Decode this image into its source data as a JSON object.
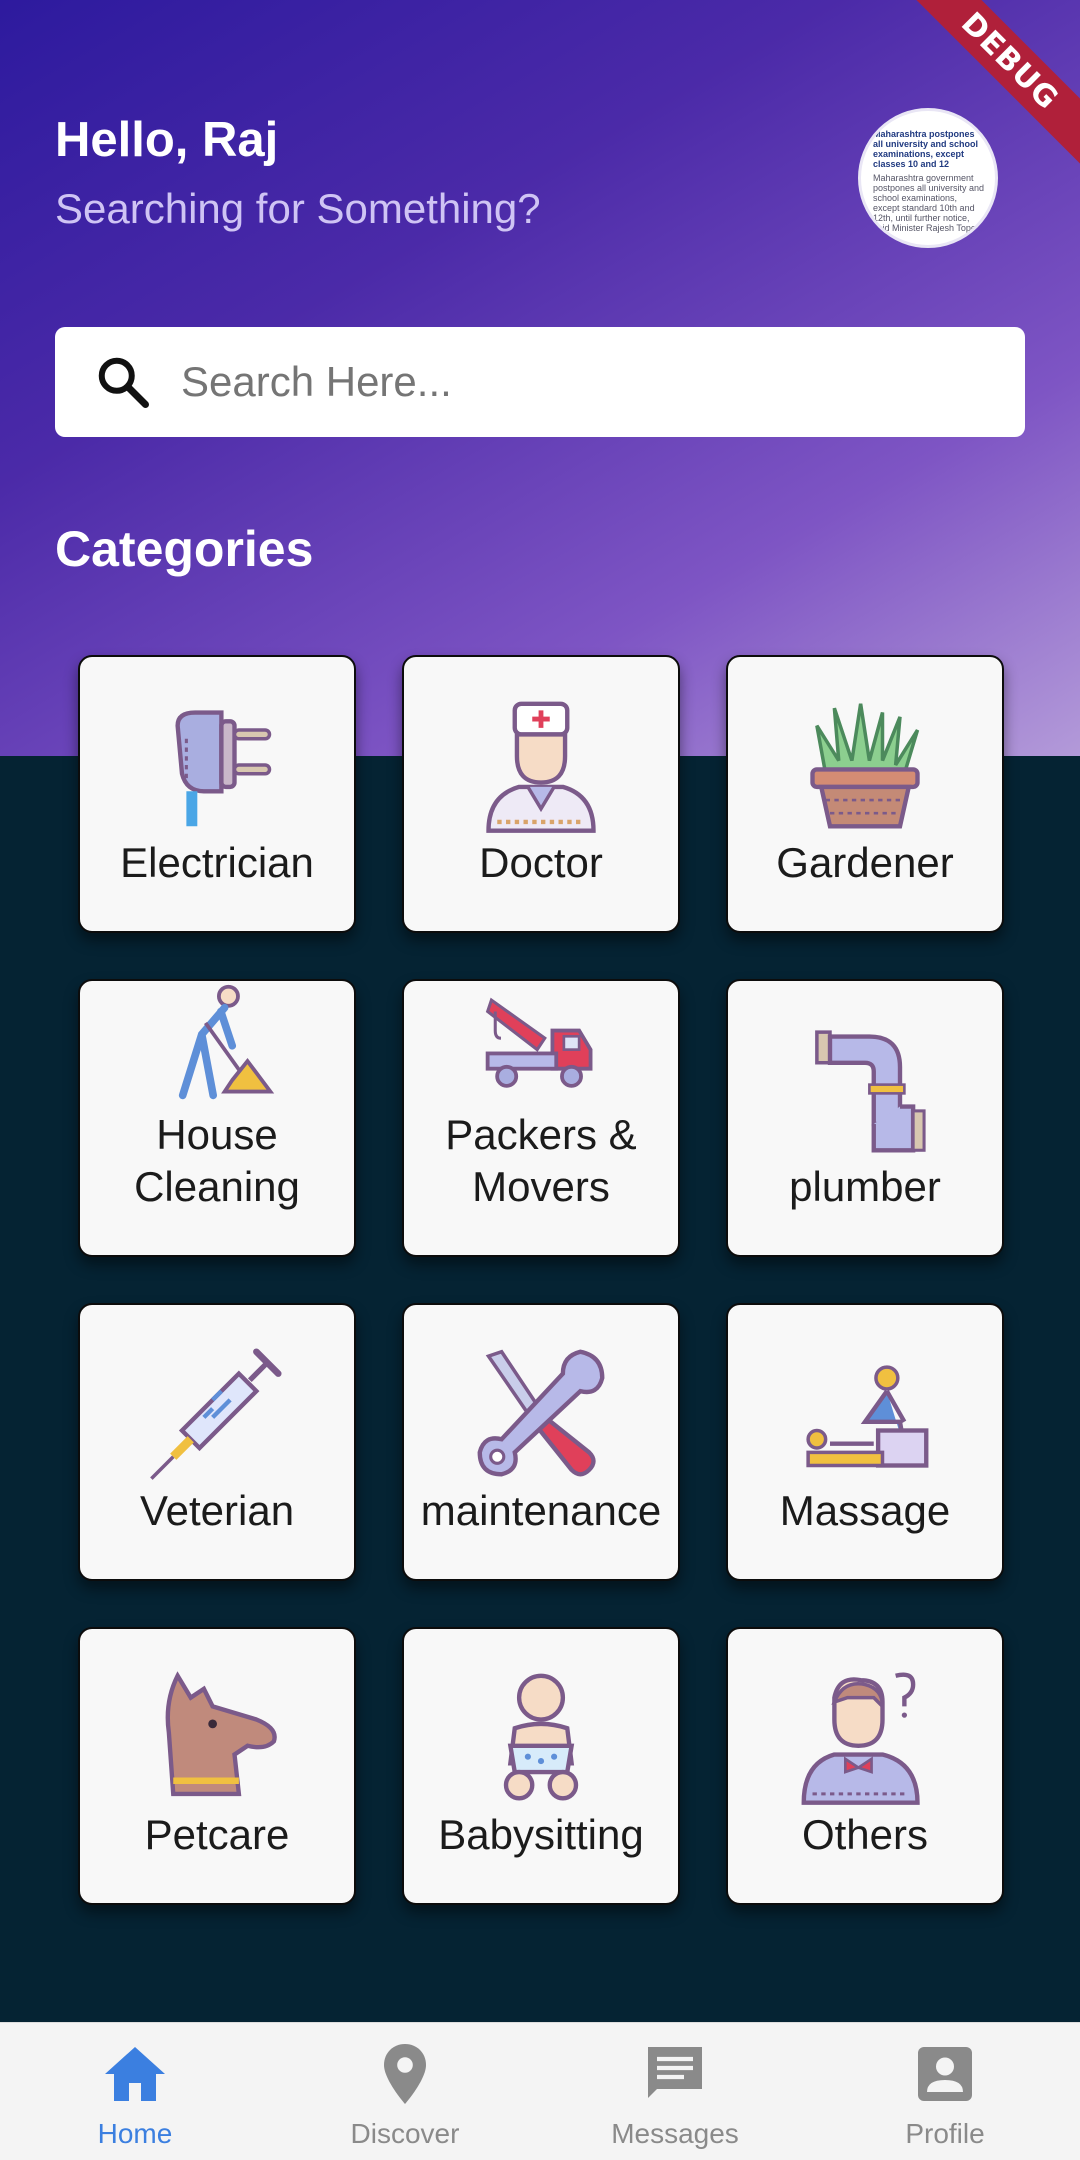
{
  "debug_banner": "DEBUG",
  "header": {
    "greeting": "Hello, Raj",
    "subtitle": "Searching for Something?",
    "avatar_text": {
      "headline": "Maharashtra postpones all university and school examinations, except classes 10 and 12",
      "body": "Maharashtra government postpones all university and school examinations, except standard 10th and 12th, until further notice, said Minister Rajesh Tope"
    }
  },
  "search": {
    "placeholder": "Search Here...",
    "icon": "search-icon"
  },
  "categories": {
    "title": "Categories",
    "items": [
      {
        "label": "Electrician",
        "icon": "plug-icon"
      },
      {
        "label": "Doctor",
        "icon": "doctor-icon"
      },
      {
        "label": "Gardener",
        "icon": "plant-pot-icon"
      },
      {
        "label": "House Cleaning",
        "icon": "shoveling-worker-icon"
      },
      {
        "label": "Packers & Movers",
        "icon": "tow-truck-icon"
      },
      {
        "label": "plumber",
        "icon": "pipe-icon"
      },
      {
        "label": "Veterian",
        "icon": "syringe-icon"
      },
      {
        "label": "maintenance",
        "icon": "wrench-screwdriver-icon"
      },
      {
        "label": "Massage",
        "icon": "massage-icon"
      },
      {
        "label": "Petcare",
        "icon": "dog-icon"
      },
      {
        "label": "Babysitting",
        "icon": "baby-icon"
      },
      {
        "label": "Others",
        "icon": "person-question-icon"
      }
    ]
  },
  "bottom_nav": {
    "items": [
      {
        "label": "Home",
        "icon": "home-icon",
        "active": true
      },
      {
        "label": "Discover",
        "icon": "location-pin-icon",
        "active": false
      },
      {
        "label": "Messages",
        "icon": "message-icon",
        "active": false
      },
      {
        "label": "Profile",
        "icon": "profile-icon",
        "active": false
      }
    ]
  },
  "colors": {
    "accent": "#3b7fe0",
    "header_gradient_start": "#2d1a9e",
    "header_gradient_end": "#b39ad9",
    "background": "#052333"
  }
}
